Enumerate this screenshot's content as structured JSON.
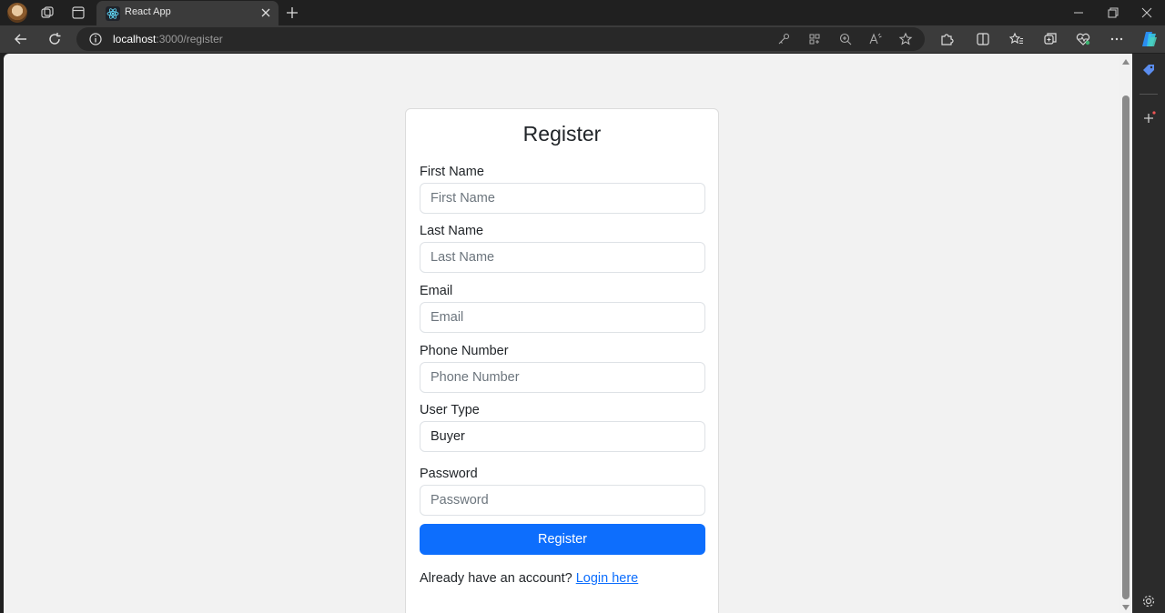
{
  "browser": {
    "tab_title": "React App",
    "url_host": "localhost",
    "url_rest": ":3000/register",
    "icons": [
      "profile-avatar",
      "workspaces-icon",
      "tab-actions-icon",
      "react-favicon",
      "close-icon",
      "new-tab-icon",
      "minimize-icon",
      "maximize-icon",
      "close-window-icon",
      "back-icon",
      "refresh-icon",
      "site-info-icon",
      "key-icon",
      "app-available-icon",
      "zoom-icon",
      "read-aloud-icon",
      "favorite-star-icon",
      "extensions-icon",
      "split-screen-icon",
      "favorites-icon",
      "collections-icon",
      "browser-essentials-icon",
      "more-menu-icon",
      "copilot-icon"
    ]
  },
  "form": {
    "title": "Register",
    "fields": [
      {
        "label": "First Name",
        "placeholder": "First Name"
      },
      {
        "label": "Last Name",
        "placeholder": "Last Name"
      },
      {
        "label": "Email",
        "placeholder": "Email"
      },
      {
        "label": "Phone Number",
        "placeholder": "Phone Number"
      },
      {
        "label": "User Type",
        "value": "Buyer"
      },
      {
        "label": "Password",
        "placeholder": "Password"
      }
    ],
    "submit_label": "Register",
    "login_prompt": "Already have an account?",
    "login_link": "Login here"
  },
  "colors": {
    "primary": "#0d6efd",
    "page_bg": "#f2f2f2",
    "browser_chrome": "#3b3b3b"
  }
}
